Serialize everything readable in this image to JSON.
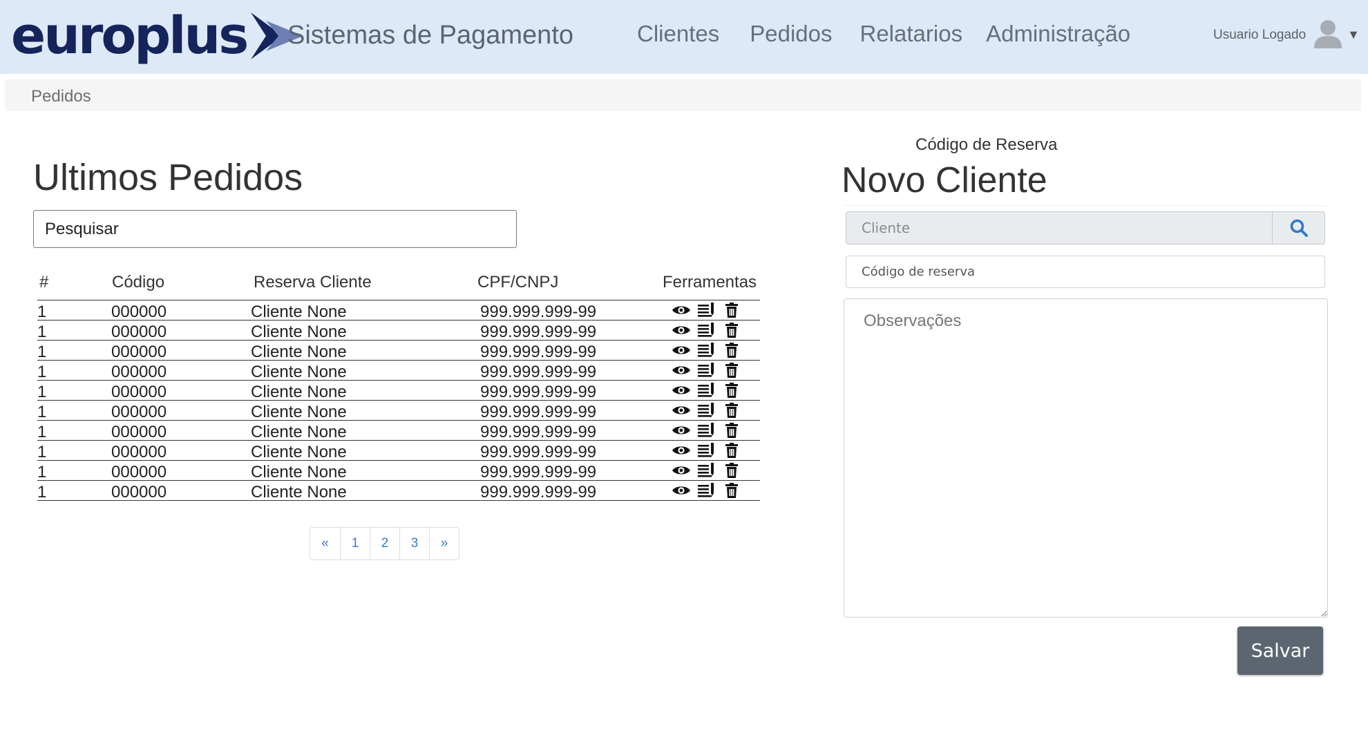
{
  "header": {
    "logo_text": "europlus",
    "subtitle": "Sistemas de Pagamento",
    "nav": [
      {
        "label": "Clientes"
      },
      {
        "label": "Pedidos"
      },
      {
        "label": "Relatarios"
      },
      {
        "label": "Administração"
      }
    ],
    "user": {
      "label": "Usuario Logado",
      "avatar_icon": "user-avatar-icon",
      "caret": "▼"
    }
  },
  "breadcrumb": {
    "items": [
      "Pedidos"
    ]
  },
  "orders": {
    "title": "Ultimos Pedidos",
    "search_value": "",
    "search_placeholder": "Pesquisar",
    "columns": [
      "#",
      "Código",
      "Reserva Cliente",
      "CPF/CNPJ",
      "Ferramentas"
    ],
    "tool_icons": [
      "eye-icon",
      "edit-list-icon",
      "trash-icon"
    ],
    "rows": [
      {
        "num": "1",
        "code": "000000",
        "client": "Cliente None",
        "doc": "999.999.999-99"
      },
      {
        "num": "1",
        "code": "000000",
        "client": "Cliente None",
        "doc": "999.999.999-99"
      },
      {
        "num": "1",
        "code": "000000",
        "client": "Cliente None",
        "doc": "999.999.999-99"
      },
      {
        "num": "1",
        "code": "000000",
        "client": "Cliente None",
        "doc": "999.999.999-99"
      },
      {
        "num": "1",
        "code": "000000",
        "client": "Cliente None",
        "doc": "999.999.999-99"
      },
      {
        "num": "1",
        "code": "000000",
        "client": "Cliente None",
        "doc": "999.999.999-99"
      },
      {
        "num": "1",
        "code": "000000",
        "client": "Cliente None",
        "doc": "999.999.999-99"
      },
      {
        "num": "1",
        "code": "000000",
        "client": "Cliente None",
        "doc": "999.999.999-99"
      },
      {
        "num": "1",
        "code": "000000",
        "client": "Cliente None",
        "doc": "999.999.999-99"
      },
      {
        "num": "1",
        "code": "000000",
        "client": "Cliente None",
        "doc": "999.999.999-99"
      }
    ],
    "pagination": {
      "prev": "«",
      "pages": [
        "1",
        "2",
        "3"
      ],
      "next": "»"
    }
  },
  "new_client": {
    "reserva_label": "Código de Reserva",
    "title": "Novo Cliente",
    "client_placeholder": "Cliente",
    "client_value": "",
    "code_placeholder": "Código de reserva",
    "code_value": "",
    "obs_placeholder": "Observações",
    "obs_value": "",
    "save_label": "Salvar"
  },
  "colors": {
    "header_bg": "#dde9f7",
    "logo": "#16245c",
    "link": "#3c7ad6",
    "save_button": "#5c6670",
    "breadcrumb_bg": "#f5f5f5"
  }
}
